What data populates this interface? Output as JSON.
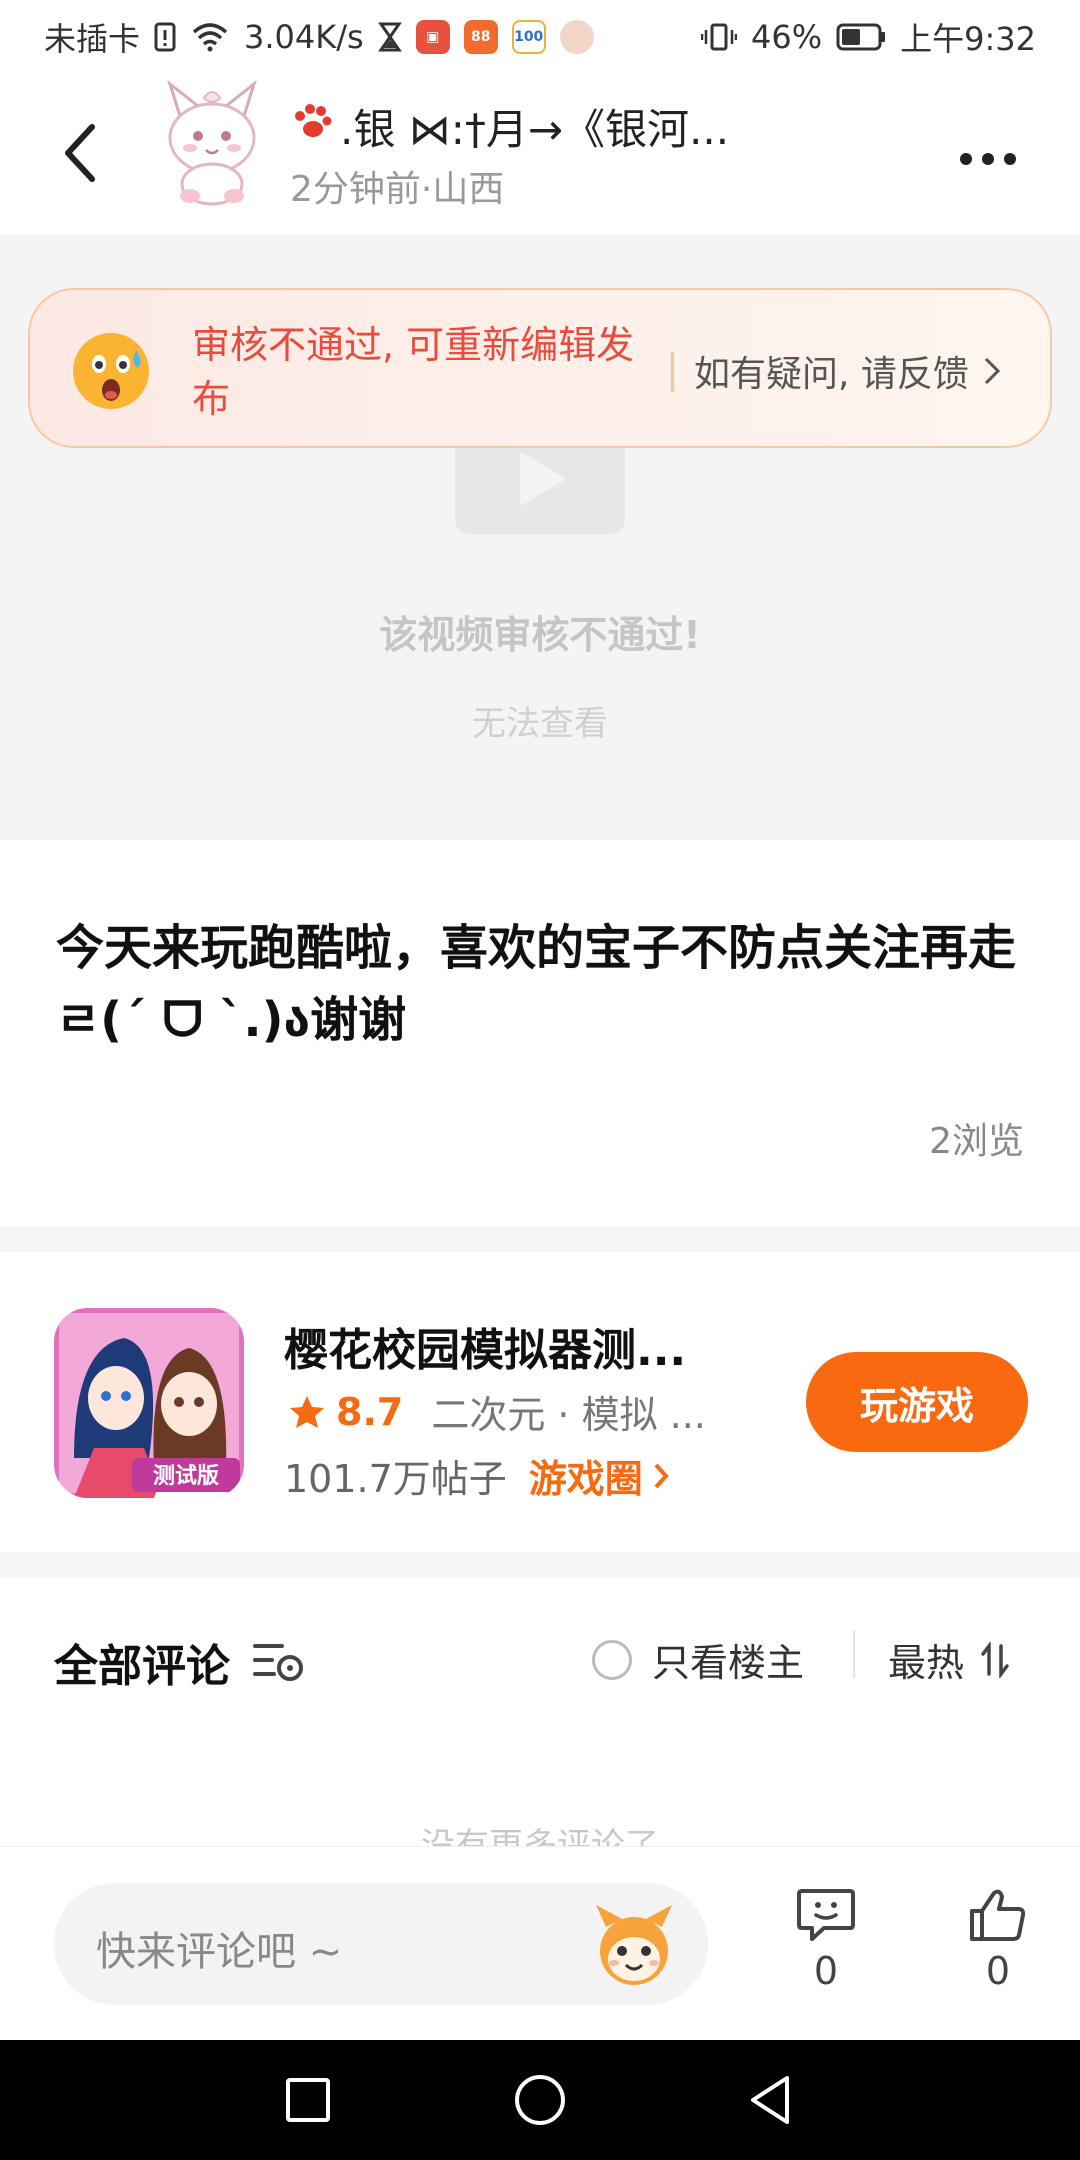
{
  "status_bar": {
    "carrier": "未插卡",
    "speed": "3.04K/s",
    "battery": "46%",
    "time": "上午9:32"
  },
  "header": {
    "author_name": ".银 ⋈:†月→《银河...",
    "post_meta": "2分钟前·山西"
  },
  "review_banner": {
    "message": "审核不通过, 可重新编辑发布",
    "feedback": "如有疑问, 请反馈"
  },
  "video": {
    "fail_title": "该视频审核不通过!",
    "fail_sub": "无法查看"
  },
  "post": {
    "title": "今天来玩跑酷啦，喜欢的宝子不防点关注再走ㄹ(ˊ ᗜ ˋ.)ა谢谢",
    "views": "2浏览"
  },
  "game": {
    "name": "樱花校园模拟器测...",
    "icon_badge": "测试版",
    "rating": "8.7",
    "tags": "二次元 · 模拟 ...",
    "posts_count": "101.7万帖子",
    "circle_link": "游戏圈",
    "play_button": "玩游戏"
  },
  "comments": {
    "title": "全部评论",
    "owner_only": "只看楼主",
    "sort": "最热",
    "no_more": "没有更多评论了"
  },
  "bottom_bar": {
    "input_placeholder": "快来评论吧 ~",
    "comment_count": "0",
    "like_count": "0"
  },
  "colors": {
    "accent": "#f96a10",
    "error_text": "#e94b3c"
  }
}
